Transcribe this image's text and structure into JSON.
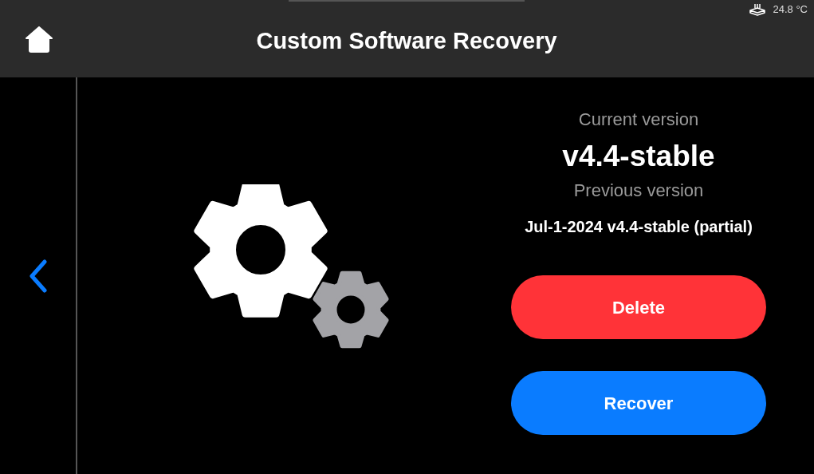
{
  "header": {
    "title": "Custom Software Recovery",
    "temperature": "24.8 °C"
  },
  "versions": {
    "current_label": "Current version",
    "current": "v4.4-stable",
    "previous_label": "Previous version",
    "previous": "Jul-1-2024 v4.4-stable (partial)"
  },
  "buttons": [
    {
      "label": "Delete",
      "kind": "danger"
    },
    {
      "label": "Recover",
      "kind": "primary"
    }
  ]
}
